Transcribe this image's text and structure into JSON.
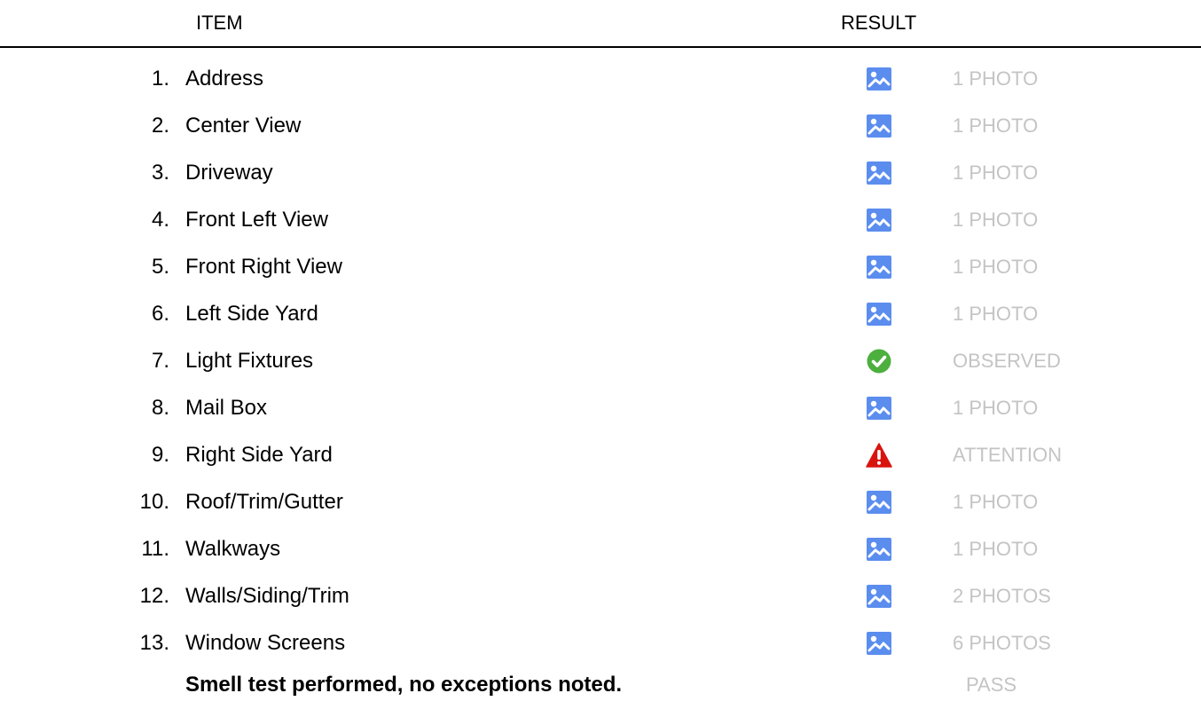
{
  "header": {
    "item_label": "ITEM",
    "result_label": "RESULT"
  },
  "items": [
    {
      "number": "1.",
      "label": "Address",
      "icon": "photo-icon",
      "result": "1 PHOTO"
    },
    {
      "number": "2.",
      "label": "Center View",
      "icon": "photo-icon",
      "result": "1 PHOTO"
    },
    {
      "number": "3.",
      "label": "Driveway",
      "icon": "photo-icon",
      "result": "1 PHOTO"
    },
    {
      "number": "4.",
      "label": "Front Left View",
      "icon": "photo-icon",
      "result": "1 PHOTO"
    },
    {
      "number": "5.",
      "label": "Front Right View",
      "icon": "photo-icon",
      "result": "1 PHOTO"
    },
    {
      "number": "6.",
      "label": "Left Side Yard",
      "icon": "photo-icon",
      "result": "1 PHOTO"
    },
    {
      "number": "7.",
      "label": "Light Fixtures",
      "icon": "check-circle-icon",
      "result": "OBSERVED"
    },
    {
      "number": "8.",
      "label": "Mail Box",
      "icon": "photo-icon",
      "result": "1 PHOTO"
    },
    {
      "number": "9.",
      "label": "Right Side Yard",
      "icon": "warning-icon",
      "result": "ATTENTION"
    },
    {
      "number": "10.",
      "label": "Roof/Trim/Gutter",
      "icon": "photo-icon",
      "result": "1 PHOTO"
    },
    {
      "number": "11.",
      "label": "Walkways",
      "icon": "photo-icon",
      "result": "1 PHOTO"
    },
    {
      "number": "12.",
      "label": "Walls/Siding/Trim",
      "icon": "photo-icon",
      "result": "2 PHOTOS"
    },
    {
      "number": "13.",
      "label": "Window Screens",
      "icon": "photo-icon",
      "result": "6 PHOTOS"
    }
  ],
  "summary": {
    "label": "Smell test performed, no exceptions noted.",
    "result": "PASS"
  },
  "colors": {
    "photo_icon": "#5b8def",
    "check_icon": "#4caf3e",
    "warning_icon": "#d9140f",
    "result_text": "#c4c4c4"
  }
}
